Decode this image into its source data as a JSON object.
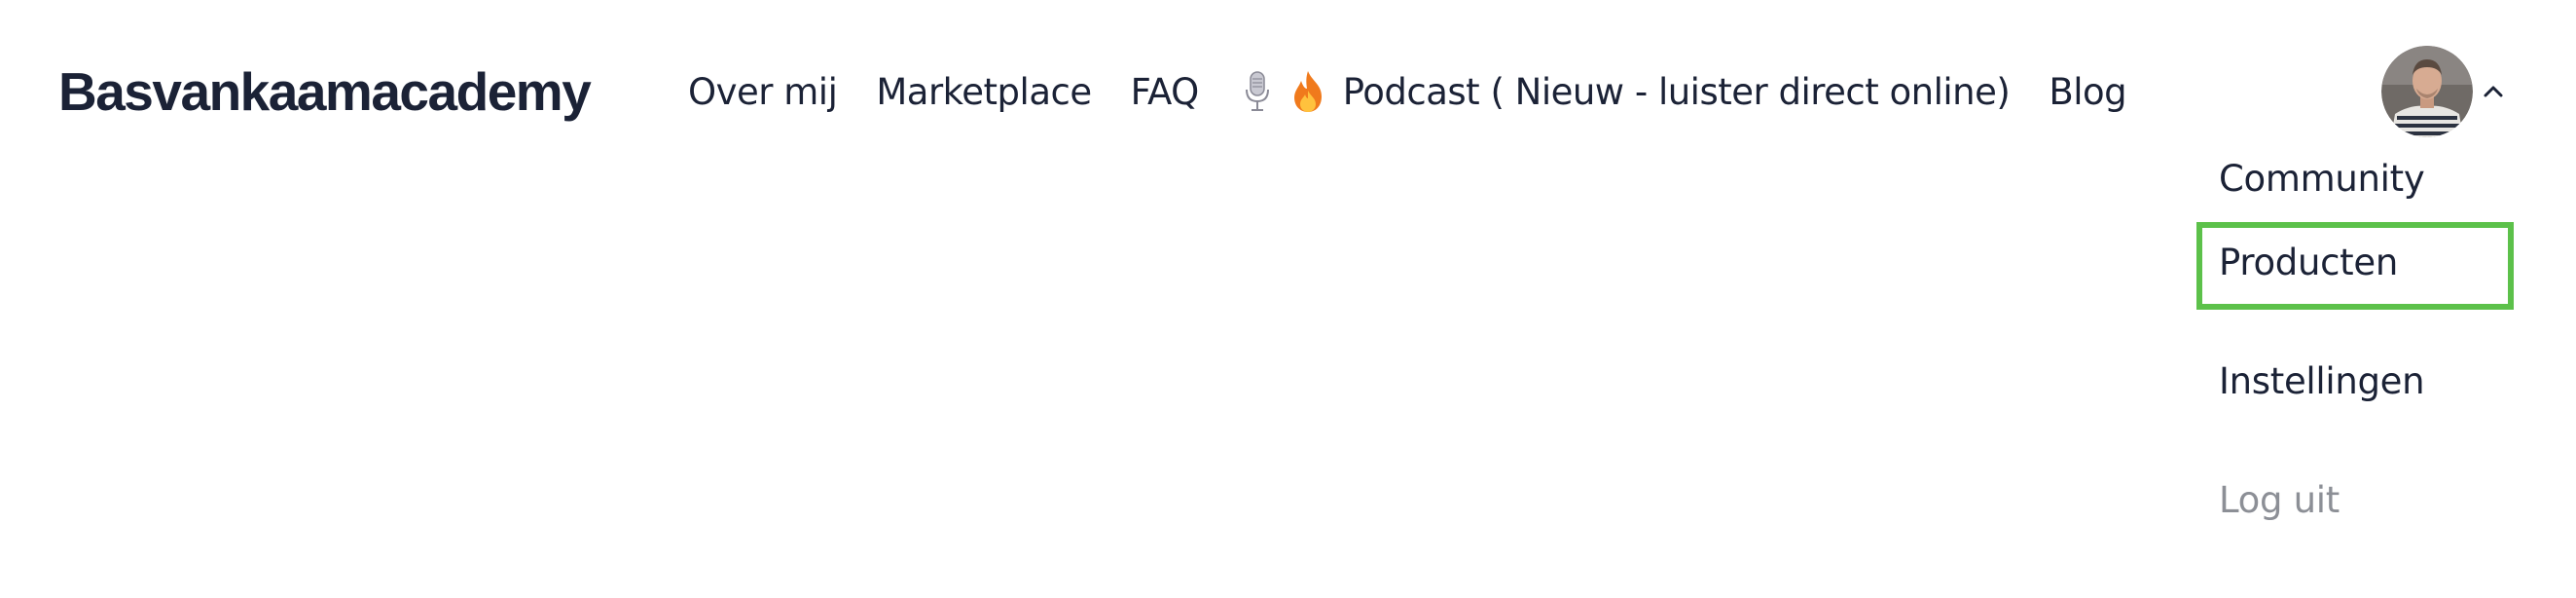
{
  "brand": {
    "name": "Basvankaamacademy"
  },
  "nav": {
    "items": [
      {
        "label": "Over mij"
      },
      {
        "label": "Marketplace"
      },
      {
        "label": "FAQ"
      },
      {
        "label": "Podcast ( Nieuw - luister direct online)",
        "icons": [
          "microphone-icon",
          "fire-icon"
        ]
      },
      {
        "label": "Blog"
      }
    ]
  },
  "user_menu": {
    "avatar_icon": "user-avatar",
    "toggle_icon": "chevron-up-icon",
    "items": [
      {
        "label": "Community"
      },
      {
        "label": "Producten",
        "highlighted": true
      },
      {
        "label": "Instellingen"
      },
      {
        "label": "Log uit",
        "muted": true
      }
    ]
  },
  "colors": {
    "text": "#1b2236",
    "muted_text": "#8c8f96",
    "highlight_border": "#5cc14a",
    "background": "#ffffff"
  }
}
